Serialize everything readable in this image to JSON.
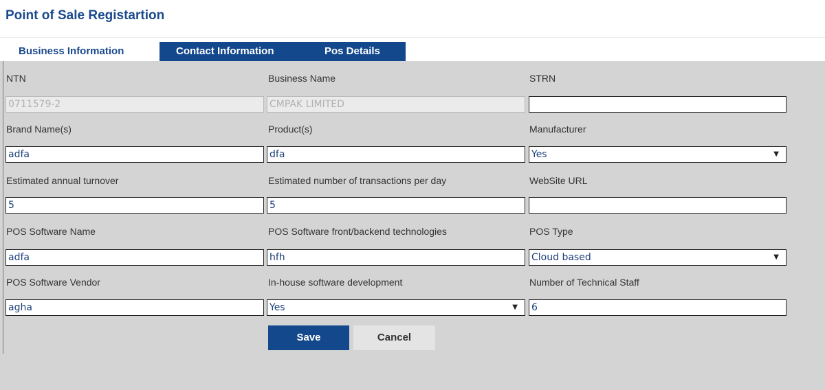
{
  "page_title": "Point of Sale Registartion",
  "tabs": {
    "business": "Business Information",
    "contact": "Contact Information",
    "pos": "Pos Details"
  },
  "form": {
    "ntn": {
      "label": "NTN",
      "value": "0711579-2"
    },
    "business_name": {
      "label": "Business Name",
      "value": "CMPAK LIMITED"
    },
    "strn": {
      "label": "STRN",
      "value": ""
    },
    "brand_names": {
      "label": "Brand Name(s)",
      "value": "adfa"
    },
    "products": {
      "label": "Product(s)",
      "value": "dfa"
    },
    "manufacturer": {
      "label": "Manufacturer",
      "value": "Yes"
    },
    "annual_turnover": {
      "label": "Estimated annual turnover",
      "value": "5"
    },
    "transactions_per_day": {
      "label": "Estimated number of transactions per day",
      "value": "5"
    },
    "website_url": {
      "label": "WebSite URL",
      "value": ""
    },
    "pos_software_name": {
      "label": "POS Software Name",
      "value": "adfa"
    },
    "pos_technologies": {
      "label": "POS Software front/backend technologies",
      "value": "hfh"
    },
    "pos_type": {
      "label": "POS Type",
      "value": "Cloud based"
    },
    "pos_vendor": {
      "label": "POS Software Vendor",
      "value": "agha"
    },
    "inhouse_development": {
      "label": "In-house software development",
      "value": "Yes"
    },
    "technical_staff": {
      "label": "Number of Technical Staff",
      "value": "6"
    }
  },
  "buttons": {
    "save": "Save",
    "cancel": "Cancel"
  },
  "icons": {
    "dropdown_caret": "▼"
  },
  "colors": {
    "brand_blue": "#13488c",
    "title_blue": "#1a4a8c",
    "panel_gray": "#d4d4d4"
  }
}
